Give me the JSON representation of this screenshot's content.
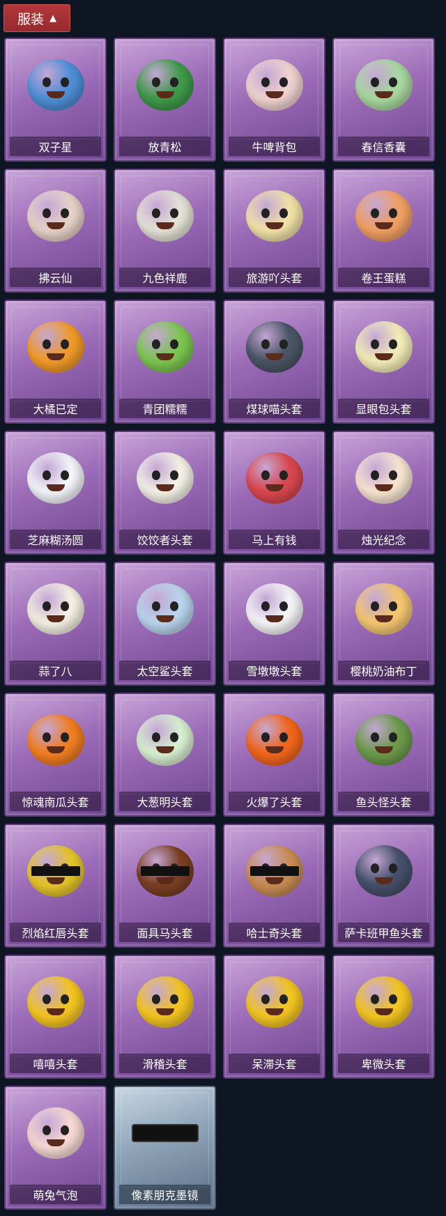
{
  "header": {
    "title": "服装"
  },
  "items": [
    {
      "label": "双子星",
      "color": "#4f8fd6",
      "icon": "planet-icon"
    },
    {
      "label": "放青松",
      "color": "#3f9a4a",
      "icon": "pine-tree-icon"
    },
    {
      "label": "牛啤背包",
      "color": "#f0d2d0",
      "icon": "cow-mug-icon"
    },
    {
      "label": "春信香囊",
      "color": "#a9d8a0",
      "icon": "sachet-icon"
    },
    {
      "label": "拂云仙",
      "color": "#e7d2c8",
      "icon": "fairy-charm-icon"
    },
    {
      "label": "九色祥鹿",
      "color": "#e4e2d6",
      "icon": "deer-charm-icon"
    },
    {
      "label": "旅游吖头套",
      "color": "#f2e2a8",
      "icon": "duck-hat-icon"
    },
    {
      "label": "卷王蛋糕",
      "color": "#f1a064",
      "icon": "roll-cake-icon"
    },
    {
      "label": "大橘已定",
      "color": "#f09a2a",
      "icon": "orange-slice-icon"
    },
    {
      "label": "青团糯糯",
      "color": "#7cc651",
      "icon": "green-dumpling-icon"
    },
    {
      "label": "煤球喵头套",
      "color": "#4b5566",
      "icon": "cat-head-icon"
    },
    {
      "label": "显眼包头套",
      "color": "#f3ecb8",
      "icon": "lightbulb-head-icon"
    },
    {
      "label": "芝麻糊汤圆",
      "color": "#f2f4fa",
      "icon": "rice-ball-icon"
    },
    {
      "label": "饺饺者头套",
      "color": "#f3f0e6",
      "icon": "dumpling-head-icon"
    },
    {
      "label": "马上有钱",
      "color": "#d9484e",
      "icon": "red-horse-icon"
    },
    {
      "label": "烛光纪念",
      "color": "#f6e3d0",
      "icon": "candle-icon"
    },
    {
      "label": "蒜了八",
      "color": "#f4efe2",
      "icon": "garlic-icon"
    },
    {
      "label": "太空鲨头套",
      "color": "#b9d4ec",
      "icon": "shark-head-icon"
    },
    {
      "label": "雪墩墩头套",
      "color": "#f4f4f7",
      "icon": "snowman-head-icon"
    },
    {
      "label": "樱桃奶油布丁",
      "color": "#f4c670",
      "icon": "pudding-icon"
    },
    {
      "label": "惊魂南瓜头套",
      "color": "#f17e21",
      "icon": "pumpkin-head-icon"
    },
    {
      "label": "大葱明头套",
      "color": "#d7eed0",
      "icon": "scallion-head-icon"
    },
    {
      "label": "火爆了头套",
      "color": "#f2661c",
      "icon": "flame-head-icon"
    },
    {
      "label": "鱼头怪头套",
      "color": "#6b9a4a",
      "icon": "fish-head-icon"
    },
    {
      "label": "烈焰红唇头套",
      "color": "#e5c429",
      "icon": "yellow-mouse-head-icon"
    },
    {
      "label": "面具马头套",
      "color": "#7b3f23",
      "icon": "horse-mask-icon"
    },
    {
      "label": "哈士奇头套",
      "color": "#c98c54",
      "icon": "husky-head-icon"
    },
    {
      "label": "萨卡班甲鱼头套",
      "color": "#46506a",
      "icon": "fish-head-blue-icon"
    },
    {
      "label": "嘻嘻头套",
      "color": "#f3c522",
      "icon": "grin-emoji-icon"
    },
    {
      "label": "滑稽头套",
      "color": "#f3c522",
      "icon": "smirk-emoji-icon"
    },
    {
      "label": "呆滞头套",
      "color": "#f3c522",
      "icon": "stare-emoji-icon"
    },
    {
      "label": "卑微头套",
      "color": "#f3c522",
      "icon": "shy-emoji-icon"
    },
    {
      "label": "萌兔气泡",
      "color": "#f6d8d2",
      "icon": "bunny-bubble-icon"
    },
    {
      "label": "像素朋克墨镜",
      "color": "#111111",
      "icon": "pixel-sunglasses-icon"
    }
  ]
}
